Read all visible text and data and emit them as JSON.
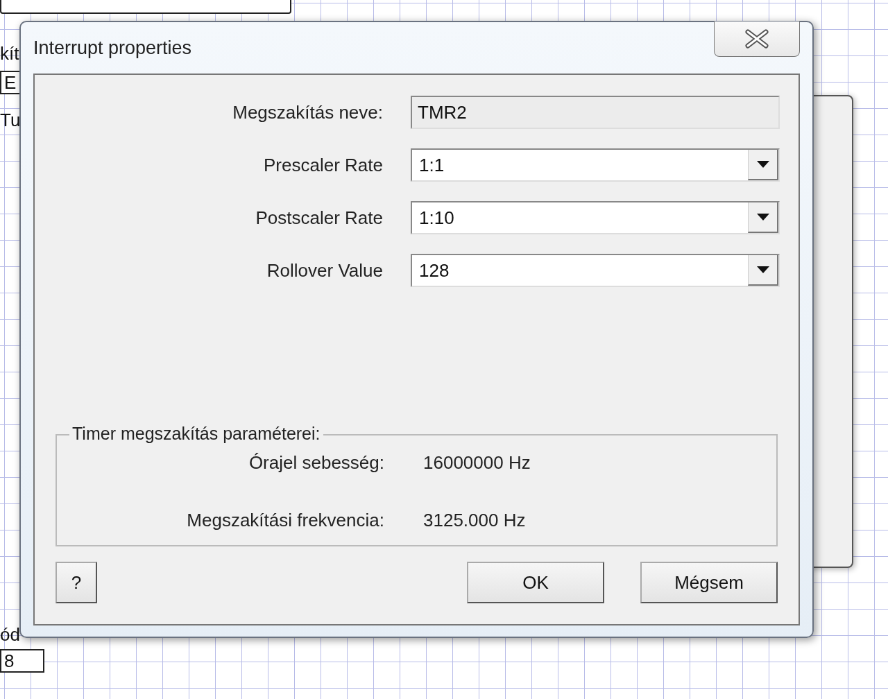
{
  "background_fragments": [
    {
      "text": "kít",
      "kind": "label"
    },
    {
      "text": "E",
      "kind": "box"
    },
    {
      "text": "Tu",
      "kind": "label"
    },
    {
      "text": "ód",
      "kind": "label"
    },
    {
      "text": "8",
      "kind": "box"
    }
  ],
  "dialog": {
    "title": "Interrupt properties",
    "fields": [
      {
        "label": "Megszakítás neve:",
        "value": "TMR2",
        "kind": "readonly"
      },
      {
        "label": "Prescaler Rate",
        "value": "1:1",
        "kind": "dropdown"
      },
      {
        "label": "Postscaler Rate",
        "value": "1:10",
        "kind": "dropdown"
      },
      {
        "label": "Rollover Value",
        "value": "128",
        "kind": "dropdown"
      }
    ],
    "group": {
      "title": "Timer megszakítás paraméterei:",
      "rows": [
        {
          "label": "Órajel sebesség:",
          "value": "16000000 Hz"
        },
        {
          "label": "Megszakítási frekvencia:",
          "value": "3125.000 Hz"
        }
      ]
    },
    "buttons": [
      {
        "label": "?",
        "kind": "help"
      },
      {
        "label": "OK",
        "kind": "ok"
      },
      {
        "label": "Mégsem",
        "kind": "cancel"
      }
    ]
  }
}
